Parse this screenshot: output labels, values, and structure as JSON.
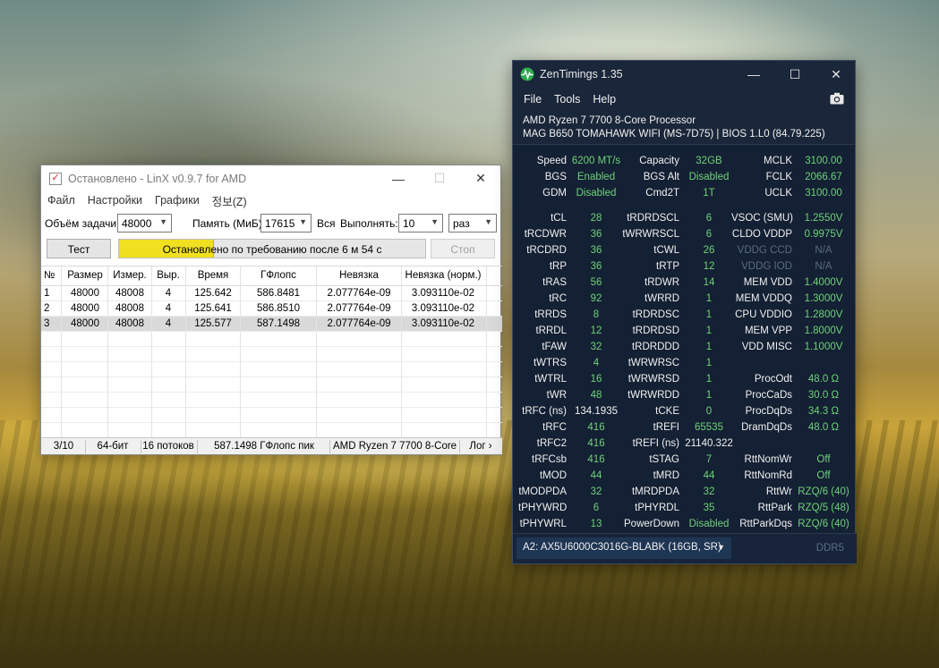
{
  "linx": {
    "title": "Остановлено - LinX v0.9.7 for AMD",
    "menu": [
      "Файл",
      "Настройки",
      "Графики",
      "정보(Z)"
    ],
    "task_size_label": "Объём задачи:",
    "task_size_value": "48000",
    "memory_label": "Память (МиБ):",
    "memory_value": "17615",
    "all_label": "Вся",
    "run_label": "Выполнять:",
    "run_value": "10",
    "run_unit": "раз",
    "test_button": "Тест",
    "stop_button": "Стоп",
    "progress_text": "Остановлено по требованию после 6 м 54 с",
    "progress_fraction": 0.31,
    "columns": [
      "№",
      "Размер",
      "Измер.",
      "Выр.",
      "Время",
      "ГФлопс",
      "Невязка",
      "Невязка (норм.)"
    ],
    "rows": [
      [
        "1",
        "48000",
        "48008",
        "4",
        "125.642",
        "586.8481",
        "2.077764e-09",
        "3.093110e-02"
      ],
      [
        "2",
        "48000",
        "48008",
        "4",
        "125.641",
        "586.8510",
        "2.077764e-09",
        "3.093110e-02"
      ],
      [
        "3",
        "48000",
        "48008",
        "4",
        "125.577",
        "587.1498",
        "2.077764e-09",
        "3.093110e-02"
      ]
    ],
    "status": [
      "3/10",
      "64-бит",
      "16 потоков",
      "587.1498 ГФлопс пик",
      "AMD Ryzen 7 7700 8-Core",
      "Лог ›"
    ]
  },
  "zen": {
    "title": "ZenTimings 1.35",
    "menu": [
      "File",
      "Tools",
      "Help"
    ],
    "cpu": "AMD Ryzen 7 7700 8-Core Processor",
    "board": "MAG B650 TOMAHAWK WIFI (MS-7D75) | BIOS 1.L0 (84.79.225)",
    "top_rows": [
      [
        "Speed",
        "6200 MT/s",
        "Capacity",
        "32GB",
        "MCLK",
        "3100.00"
      ],
      [
        "BGS",
        "Enabled",
        "BGS Alt",
        "Disabled",
        "FCLK",
        "2066.67"
      ],
      [
        "GDM",
        "Disabled",
        "Cmd2T",
        "1T",
        "UCLK",
        "3100.00"
      ]
    ],
    "timing_rows": [
      [
        "tCL",
        "28",
        "tRDRDSCL",
        "6",
        "VSOC (SMU)",
        "1.2550V"
      ],
      [
        "tRCDWR",
        "36",
        "tWRWRSCL",
        "6",
        "CLDO VDDP",
        "0.9975V"
      ],
      [
        "tRCDRD",
        "36",
        "tCWL",
        "26",
        "VDDG CCD",
        "N/A"
      ],
      [
        "tRP",
        "36",
        "tRTP",
        "12",
        "VDDG IOD",
        "N/A"
      ],
      [
        "tRAS",
        "56",
        "tRDWR",
        "14",
        "MEM VDD",
        "1.4000V"
      ],
      [
        "tRC",
        "92",
        "tWRRD",
        "1",
        "MEM VDDQ",
        "1.3000V"
      ],
      [
        "tRRDS",
        "8",
        "tRDRDSC",
        "1",
        "CPU VDDIO",
        "1.2800V"
      ],
      [
        "tRRDL",
        "12",
        "tRDRDSD",
        "1",
        "MEM VPP",
        "1.8000V"
      ],
      [
        "tFAW",
        "32",
        "tRDRDDD",
        "1",
        "VDD MISC",
        "1.1000V"
      ],
      [
        "tWTRS",
        "4",
        "tWRWRSC",
        "1",
        "",
        ""
      ],
      [
        "tWTRL",
        "16",
        "tWRWRSD",
        "1",
        "ProcOdt",
        "48.0 Ω"
      ],
      [
        "tWR",
        "48",
        "tWRWRDD",
        "1",
        "ProcCaDs",
        "30.0 Ω"
      ],
      [
        "tRFC (ns)",
        "134.1935",
        "tCKE",
        "0",
        "ProcDqDs",
        "34.3 Ω"
      ],
      [
        "tRFC",
        "416",
        "tREFI",
        "65535",
        "DramDqDs",
        "48.0 Ω"
      ],
      [
        "tRFC2",
        "416",
        "tREFI (ns)",
        "21140.322",
        "",
        ""
      ],
      [
        "tRFCsb",
        "416",
        "tSTAG",
        "7",
        "RttNomWr",
        "Off"
      ],
      [
        "tMOD",
        "44",
        "tMRD",
        "44",
        "RttNomRd",
        "Off"
      ],
      [
        "tMODPDA",
        "32",
        "tMRDPDA",
        "32",
        "RttWr",
        "RZQ/6 (40)"
      ],
      [
        "tPHYWRD",
        "6",
        "tPHYRDL",
        "35",
        "RttPark",
        "RZQ/5 (48)"
      ],
      [
        "tPHYWRL",
        "13",
        "PowerDown",
        "Disabled",
        "RttParkDqs",
        "RZQ/6 (40)"
      ]
    ],
    "dimm_select": "A2: AX5U6000C3016G-BLABK (16GB, SR)",
    "ddr_label": "DDR5",
    "colors": {
      "value": "#6fd27a",
      "dim": "#5b6b80",
      "bg": "#142033"
    }
  }
}
